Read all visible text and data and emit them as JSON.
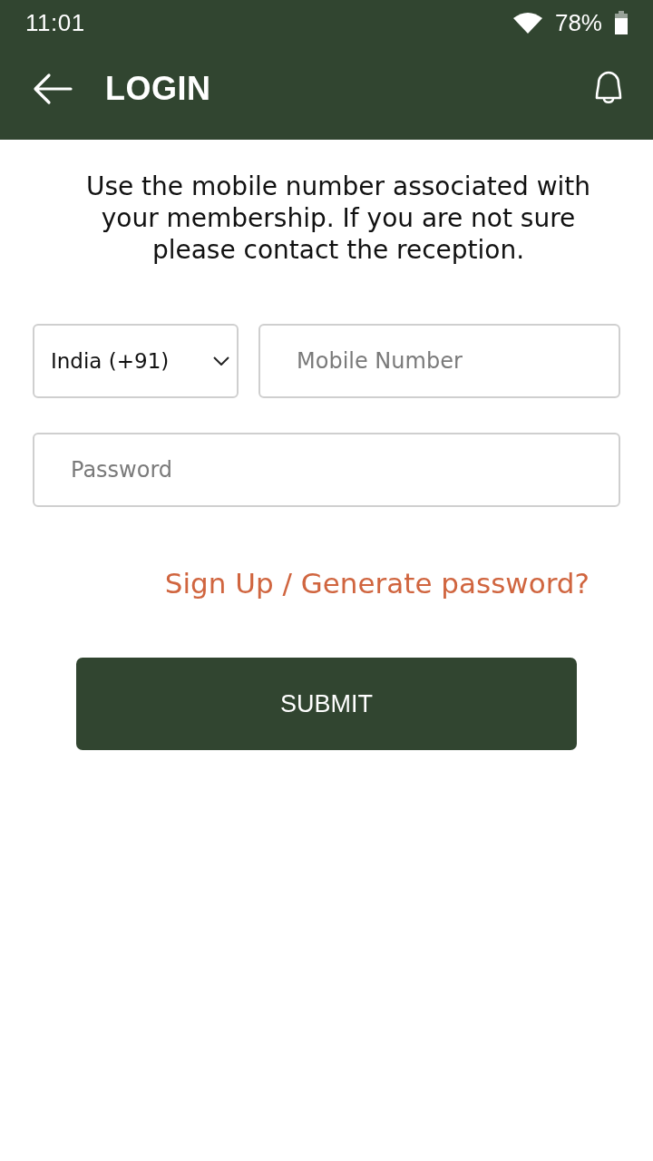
{
  "status_bar": {
    "time": "11:01",
    "battery": "78%"
  },
  "app_bar": {
    "title": "LOGIN"
  },
  "instructions": "Use the mobile number associated with your membership. If you are not sure please contact the reception.",
  "form": {
    "country": {
      "value": "India (+91)"
    },
    "mobile": {
      "placeholder": "Mobile Number"
    },
    "password": {
      "placeholder": "Password"
    }
  },
  "signup_link": "Sign Up / Generate password?",
  "buttons": [
    {
      "label": "SUBMIT"
    }
  ]
}
